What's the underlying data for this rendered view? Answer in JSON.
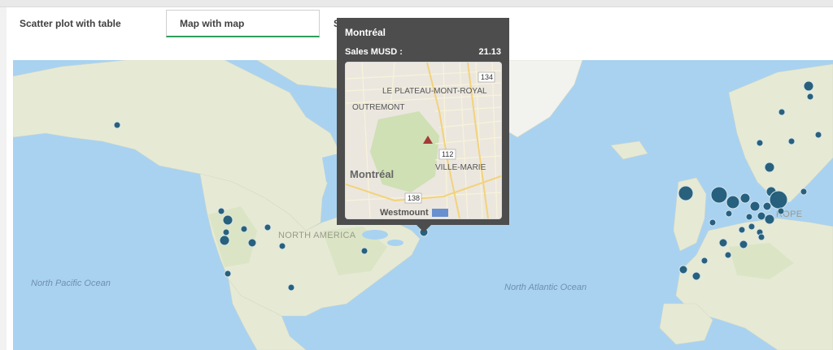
{
  "tabs": [
    {
      "label": "Scatter plot with table",
      "active": false
    },
    {
      "label": "Map with map",
      "active": true
    },
    {
      "label": "S",
      "active": false
    }
  ],
  "map": {
    "labels": {
      "north_america": "NORTH AMERICA",
      "north_pacific": "North Pacific Ocean",
      "north_atlantic": "North Atlantic Ocean",
      "europe": "ROPE"
    }
  },
  "tooltip": {
    "city": "Montréal",
    "measure_label": "Sales MUSD :",
    "measure_value": "21.13",
    "mini_map": {
      "labels": {
        "plateau": "LE PLATEAU-MONT-ROYAL",
        "outremont": "OUTREMONT",
        "montreal": "Montréal",
        "ville_marie": "VILLE-MARIE",
        "westmount": "Westmount"
      },
      "shields": [
        "134",
        "112",
        "138"
      ]
    }
  },
  "colors": {
    "bubble": "#1f5a78",
    "ocean": "#a9d2f0",
    "land": "#e8ecd8",
    "tooltip_bg": "#4d4d4d",
    "active_tab_underline": "#2e9d5b"
  }
}
